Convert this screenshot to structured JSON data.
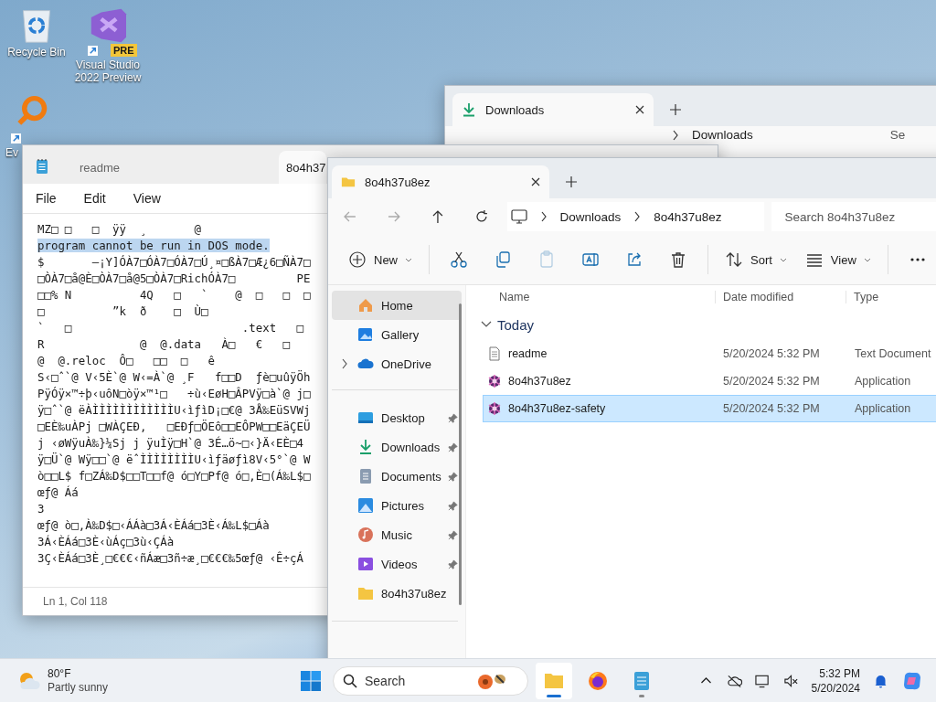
{
  "desktop_icons": [
    {
      "kind": "recycle-bin",
      "label": "Recycle Bin",
      "shortcut": false
    },
    {
      "kind": "visual-studio",
      "label": "Visual Studio 2022 Preview",
      "badge": "PRE",
      "shortcut": true
    },
    {
      "kind": "magnifier",
      "label": "Ev",
      "shortcut": true
    }
  ],
  "back_window": {
    "tab": {
      "label": "Downloads",
      "selected": true
    },
    "breadcrumb": [
      "Downloads"
    ],
    "search": {
      "placeholder": "Se"
    }
  },
  "notepad": {
    "tabs": [
      {
        "label": "readme",
        "selected": false
      },
      {
        "label": "8o4h37",
        "selected": true
      }
    ],
    "menu": [
      "File",
      "Edit",
      "View"
    ],
    "lines": [
      {
        "text": "MZ□ □   □  ÿÿ  ¸       @",
        "selected": false
      },
      {
        "text": "program cannot be run in DOS mode.",
        "selected": true
      },
      {
        "text": "$       —¡Y]ÓÀ7□ÓÀ7□ÓÀ7□Ú¸¤□ßÀ7□Æ¿6□ÑÀ7□",
        "selected": false
      },
      {
        "text": "□ÒÀ7□å@È□ÒÀ7□å@5□ÒÀ7□RichÓÀ7□         PE",
        "selected": false
      },
      {
        "text": "□□% N          4Q   □   `    @  □   □  □",
        "selected": false
      },
      {
        "text": "□          ”k  ð    □  Ù□",
        "selected": false
      },
      {
        "text": "`   □                         .text   □",
        "selected": false
      },
      {
        "text": "R              @  @.data   À□   €   □",
        "selected": false
      },
      {
        "text": "@  @.reloc  Ô□   □□  □   ê",
        "selected": false
      },
      {
        "text": "S‹□ˆ`@ V‹5È`@ W‹=À`@ ¸F   f□□D  ƒè□uûÿÖh",
        "selected": false
      },
      {
        "text": "PÿÓÿ×™÷þ‹uôN□òÿ×™¹□   ÷ù‹EøH□ÂPVÿ□à`@ j□",
        "selected": false
      },
      {
        "text": "ÿ□ˆ`@ ëÀÌÌÌÌÌÌÌÌÌÌÌÌU‹ìƒìD¡□€@ 3Å‰EüSVWj",
        "selected": false
      },
      {
        "text": "□EÈ‰uÀPj □WÀÇEÐ,   □EÐƒ□ÖEô□□EÔPW□□EäÇEÜ",
        "selected": false
      },
      {
        "text": "j ‹øWÿuÀ‰}¼Sj j ÿuÌÿ□H`@ 3É…ö~□‹}Ä‹EÈ□4",
        "selected": false
      },
      {
        "text": "ÿ□Ü`@ Wÿ□□`@ ëˆÌÌÌÌÌÌÌÌU‹ìƒäøƒì8V‹5°`@ W",
        "selected": false
      },
      {
        "text": "ò□□L$ f□ZÁ‰D$□□T□□f@ ó□Y□Pf@ ó□,È□(Á‰L$□",
        "selected": false
      },
      {
        "text": "œƒ@ Áá",
        "selected": false
      },
      {
        "text": "3",
        "selected": false
      },
      {
        "text": "œƒ@ ò□,À‰D$□‹ÁÁà□3Á‹ÈÁá□3È‹Á‰L$□Áà",
        "selected": false
      },
      {
        "text": "3Á‹ÈÁá□3È‹ùÁç□3ù‹ÇÁà",
        "selected": false
      },
      {
        "text": "3Ç‹ÈÁá□3È¸□€€€‹ñÁæ□3ñ÷æ¸□€€€‰5œƒ@ ‹Ê÷çÁ",
        "selected": false
      }
    ],
    "status": "Ln 1, Col 118"
  },
  "explorer": {
    "tabs": [
      {
        "label": "8o4h37u8ez",
        "selected": true
      }
    ],
    "breadcrumb": [
      "Downloads",
      "8o4h37u8ez"
    ],
    "search": {
      "placeholder": "Search 8o4h37u8ez"
    },
    "commands": [
      {
        "kind": "new",
        "label": "New",
        "disabled": false
      },
      {
        "kind": "separator"
      },
      {
        "kind": "cut",
        "disabled": false
      },
      {
        "kind": "copy",
        "disabled": false
      },
      {
        "kind": "paste",
        "disabled": true
      },
      {
        "kind": "rename",
        "disabled": false
      },
      {
        "kind": "share",
        "disabled": false
      },
      {
        "kind": "delete",
        "disabled": false
      },
      {
        "kind": "separator"
      },
      {
        "kind": "sort",
        "label": "Sort",
        "disabled": false
      },
      {
        "kind": "view",
        "label": "View",
        "disabled": false
      },
      {
        "kind": "separator"
      },
      {
        "kind": "more",
        "disabled": false
      }
    ],
    "sidebar": {
      "sections": [
        [
          {
            "kind": "home",
            "label": "Home",
            "selected": true,
            "pinned": false,
            "expandable": false
          },
          {
            "kind": "gallery",
            "label": "Gallery",
            "selected": false,
            "pinned": false,
            "expandable": false
          },
          {
            "kind": "onedrive",
            "label": "OneDrive",
            "selected": false,
            "pinned": false,
            "expandable": true
          }
        ],
        [
          {
            "kind": "desktop",
            "label": "Desktop",
            "selected": false,
            "pinned": true,
            "expandable": false
          },
          {
            "kind": "downloads",
            "label": "Downloads",
            "selected": false,
            "pinned": true,
            "expandable": false
          },
          {
            "kind": "documents",
            "label": "Documents",
            "selected": false,
            "pinned": true,
            "expandable": false
          },
          {
            "kind": "pictures",
            "label": "Pictures",
            "selected": false,
            "pinned": true,
            "expandable": false
          },
          {
            "kind": "music",
            "label": "Music",
            "selected": false,
            "pinned": true,
            "expandable": false
          },
          {
            "kind": "videos",
            "label": "Videos",
            "selected": false,
            "pinned": true,
            "expandable": false
          },
          {
            "kind": "folder",
            "label": "8o4h37u8ez",
            "selected": false,
            "pinned": false,
            "expandable": false
          }
        ]
      ]
    },
    "columns": [
      "Name",
      "Date modified",
      "Type"
    ],
    "groups": [
      {
        "label": "Today",
        "expanded": true,
        "files": [
          {
            "kind": "text",
            "name": "readme",
            "date": "5/20/2024 5:32 PM",
            "type": "Text Document",
            "selected": false
          },
          {
            "kind": "app",
            "name": "8o4h37u8ez",
            "date": "5/20/2024 5:32 PM",
            "type": "Application",
            "selected": false
          },
          {
            "kind": "app",
            "name": "8o4h37u8ez-safety",
            "date": "5/20/2024 5:32 PM",
            "type": "Application",
            "selected": true
          }
        ]
      }
    ]
  },
  "taskbar": {
    "weather": {
      "temperature": "80°F",
      "condition": "Partly sunny"
    },
    "search": {
      "placeholder": "Search"
    },
    "apps": [
      {
        "kind": "file-explorer",
        "active": true,
        "running": true
      },
      {
        "kind": "firefox",
        "active": false,
        "running": false
      },
      {
        "kind": "notepad",
        "active": false,
        "running": true
      }
    ],
    "clock": {
      "time": "5:32 PM",
      "date": "5/20/2024"
    }
  }
}
